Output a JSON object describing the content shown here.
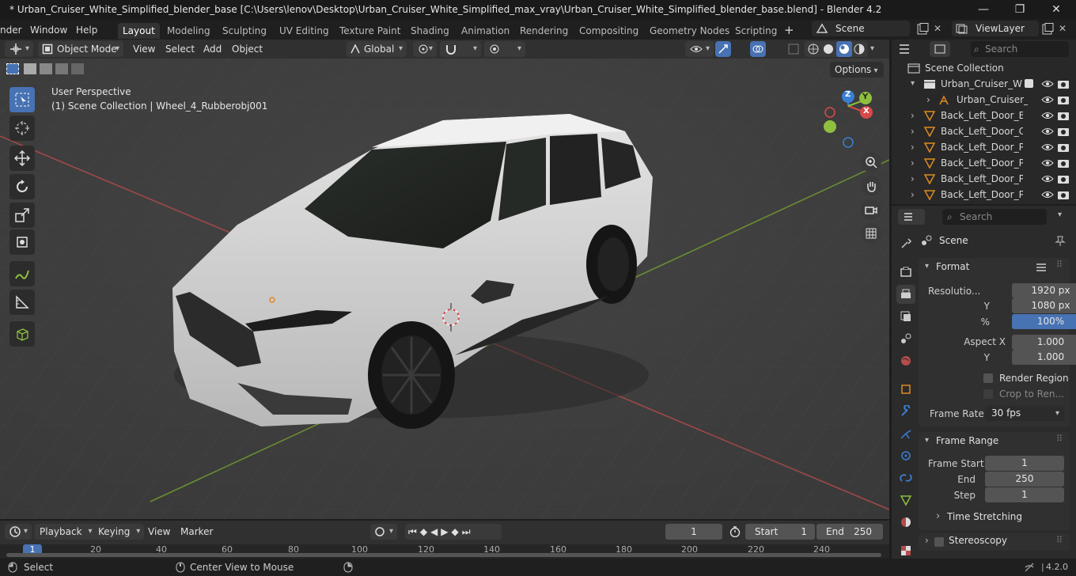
{
  "window": {
    "title": "* Urban_Cruiser_White_Simplified_blender_base [C:\\Users\\lenov\\Desktop\\Urban_Cruiser_White_Simplified_max_vray\\Urban_Cruiser_White_Simplified_blender_base.blend] - Blender 4.2",
    "minimize": "—",
    "maximize": "❐",
    "close": "✕"
  },
  "menu": {
    "items": [
      "nder",
      "Window",
      "Help"
    ],
    "workspaces": [
      "Layout",
      "Modeling",
      "Sculpting",
      "UV Editing",
      "Texture Paint",
      "Shading",
      "Animation",
      "Rendering",
      "Compositing",
      "Geometry Nodes",
      "Scripting"
    ],
    "add_tab": "+",
    "scene": "Scene",
    "view_layer": "ViewLayer"
  },
  "viewport_header": {
    "mode": "Object Mode",
    "menus": [
      "View",
      "Select",
      "Add",
      "Object"
    ],
    "orientation": "Global",
    "options": "Options"
  },
  "viewport": {
    "perspective": "User Perspective",
    "collection_info": "(1) Scene Collection | Wheel_4_Rubberobj001",
    "gizmo": {
      "x": "X",
      "y": "Y",
      "z": "Z"
    }
  },
  "outliner": {
    "search_placeholder": "Search",
    "root": "Scene Collection",
    "rows": [
      {
        "label": "Urban_Cruiser_Whi"
      },
      {
        "label": "Urban_Cruiser_"
      },
      {
        "label": "Back_Left_Door_Bo"
      },
      {
        "label": "Back_Left_Door_Clo"
      },
      {
        "label": "Back_Left_Door_Pla"
      },
      {
        "label": "Back_Left_Door_Pla"
      },
      {
        "label": "Back_Left_Door_Pla"
      },
      {
        "label": "Back_Left_Door_Pla"
      }
    ]
  },
  "properties": {
    "search_placeholder": "Search",
    "context": "Scene",
    "format": {
      "title": "Format",
      "resolution_label": "Resolutio...",
      "res_x": "1920 px",
      "y_label": "Y",
      "res_y": "1080 px",
      "pct_label": "%",
      "pct": "100%",
      "aspect_label": "Aspect X",
      "aspect_x": "1.000",
      "aspect_y": "1.000",
      "render_region": "Render Region",
      "crop": "Crop to Ren...",
      "frame_rate_label": "Frame Rate",
      "frame_rate": "30 fps"
    },
    "frame_range": {
      "title": "Frame Range",
      "start_label": "Frame Start",
      "start": "1",
      "end_label": "End",
      "end": "250",
      "step_label": "Step",
      "step": "1",
      "time_stretching": "Time Stretching"
    },
    "stereoscopy": "Stereoscopy"
  },
  "timeline": {
    "menus": [
      "Playback",
      "Keying",
      "View",
      "Marker"
    ],
    "current_frame": "1",
    "start_label": "Start",
    "start": "1",
    "end_label": "End",
    "end": "250",
    "ruler": [
      "1",
      "20",
      "40",
      "60",
      "80",
      "100",
      "120",
      "140",
      "160",
      "180",
      "200",
      "220",
      "240"
    ]
  },
  "status": {
    "select": "Select",
    "center_view": "Center View to Mouse",
    "version": "4.2.0"
  },
  "colors": {
    "accent": "#4772b3",
    "x_axis": "#d84a4a",
    "y_axis": "#8fbf3f",
    "z_axis": "#3a7fd5"
  }
}
